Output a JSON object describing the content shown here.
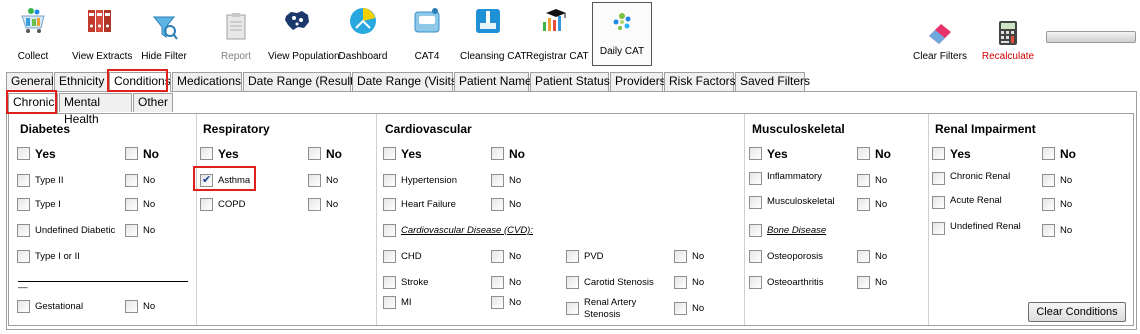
{
  "toolbar": {
    "buttons": [
      {
        "label": "Collect",
        "icon": "collect-icon"
      },
      {
        "label": "View Extracts",
        "icon": "view-extracts-icon"
      },
      {
        "label": "Hide Filter",
        "icon": "hide-filter-icon"
      },
      {
        "label": "Report",
        "icon": "report-icon"
      },
      {
        "label": "View Population",
        "icon": "view-population-icon"
      },
      {
        "label": "Dashboard",
        "icon": "dashboard-icon"
      },
      {
        "label": "CAT4",
        "icon": "cat4-icon"
      },
      {
        "label": "Cleansing CAT",
        "icon": "cleansing-cat-icon"
      },
      {
        "label": "Registrar CAT",
        "icon": "registrar-cat-icon"
      },
      {
        "label": "Daily CAT",
        "icon": "daily-cat-icon"
      }
    ],
    "right_buttons": [
      {
        "label": "Clear Filters",
        "icon": "clear-filters-icon"
      },
      {
        "label": "Recalculate",
        "icon": "recalculate-icon"
      }
    ],
    "progress_fraction": 0.0
  },
  "tabs": [
    "General",
    "Ethnicity",
    "Conditions",
    "Medications",
    "Date Range (Results)",
    "Date Range (Visits)",
    "Patient Name",
    "Patient Status",
    "Providers",
    "Risk Factors",
    "Saved Filters"
  ],
  "selected_tab": "Conditions",
  "subtabs": [
    "Chronic",
    "Mental Health",
    "Other"
  ],
  "selected_subtab": "Chronic",
  "yes_label": "Yes",
  "no_label": "No",
  "sections": {
    "diabetes": {
      "title": "Diabetes",
      "items": [
        "Type II",
        "Type I",
        "Undefined Diabetic",
        "Type I or II",
        "Gestational"
      ],
      "separator_mark": "—"
    },
    "respiratory": {
      "title": "Respiratory",
      "items": [
        "Asthma",
        "COPD"
      ],
      "checked": [
        "Asthma"
      ]
    },
    "cardiovascular": {
      "title": "Cardiovascular",
      "items": [
        "Hypertension",
        "Heart Failure"
      ],
      "cvd_heading": "Cardiovascular Disease (CVD):",
      "cvd_items_left": [
        "CHD",
        "Stroke",
        "MI"
      ],
      "cvd_items_right": [
        "PVD",
        "Carotid Stenosis",
        "Renal Artery Stenosis"
      ]
    },
    "musculoskeletal": {
      "title": "Musculoskeletal",
      "items": [
        "Inflammatory",
        "Musculoskeletal"
      ],
      "bone_heading": "Bone Disease",
      "bone_items": [
        "Osteoporosis",
        "Osteoarthritis"
      ]
    },
    "renal": {
      "title": "Renal Impairment",
      "items": [
        "Chronic Renal",
        "Acute Renal",
        "Undefined Renal"
      ]
    }
  },
  "clear_conditions_label": "Clear Conditions",
  "colors": {
    "highlight": "#e0201b",
    "recalculate": "#cc0000"
  }
}
